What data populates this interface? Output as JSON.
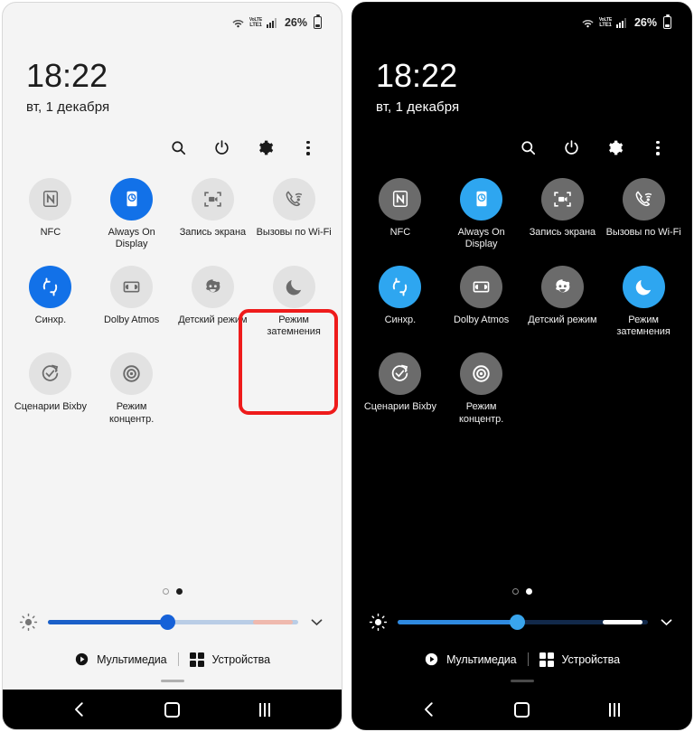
{
  "statusbar": {
    "wifi_icon": "wifi-icon",
    "volte_line1": "VoLTE",
    "volte_line2": "LTE1",
    "signal_icon": "signal-bars-icon",
    "battery_percent": "26%",
    "battery_icon": "battery-icon"
  },
  "clock": {
    "time": "18:22",
    "date": "вт, 1 декабря"
  },
  "toolbar": {
    "search": "search-icon",
    "power": "power-icon",
    "settings": "gear-icon",
    "more": "kebab-menu-icon"
  },
  "tiles": [
    {
      "label": "NFC",
      "icon": "nfc-icon",
      "on_light": false,
      "on_dark": false
    },
    {
      "label": "Always On Display",
      "icon": "always-on-display-icon",
      "on_light": true,
      "on_dark": true
    },
    {
      "label": "Запись экрана",
      "icon": "screen-record-icon",
      "on_light": false,
      "on_dark": false
    },
    {
      "label": "Вызовы по Wi-Fi",
      "icon": "wifi-calling-icon",
      "on_light": false,
      "on_dark": false
    },
    {
      "label": "Синхр.",
      "icon": "sync-icon",
      "on_light": true,
      "on_dark": true
    },
    {
      "label": "Dolby Atmos",
      "icon": "dolby-atmos-icon",
      "on_light": false,
      "on_dark": false
    },
    {
      "label": "Детский режим",
      "icon": "kids-mode-icon",
      "on_light": false,
      "on_dark": false
    },
    {
      "label": "Режим затемнения",
      "icon": "dark-mode-moon-icon",
      "on_light": false,
      "on_dark": true
    },
    {
      "label": "Сценарии Bixby",
      "icon": "bixby-routines-icon",
      "on_light": false,
      "on_dark": false
    },
    {
      "label": "Режим концентр.",
      "icon": "focus-mode-icon",
      "on_light": false,
      "on_dark": false
    }
  ],
  "brightness": {
    "icon": "brightness-icon",
    "value_percent": 48,
    "expand_icon": "chevron-down-icon"
  },
  "pager": {
    "dots": 2,
    "active_index": 1
  },
  "footer": {
    "media_label": "Мультимедиа",
    "media_icon": "play-circle-icon",
    "devices_label": "Устройства",
    "devices_icon": "grid-squares-icon"
  },
  "navbar": {
    "back": "back-chevron-icon",
    "home": "home-square-icon",
    "recents": "recents-icon"
  },
  "highlight": {
    "color": "#ee1b1b",
    "target_tile": "Режим затемнения"
  }
}
